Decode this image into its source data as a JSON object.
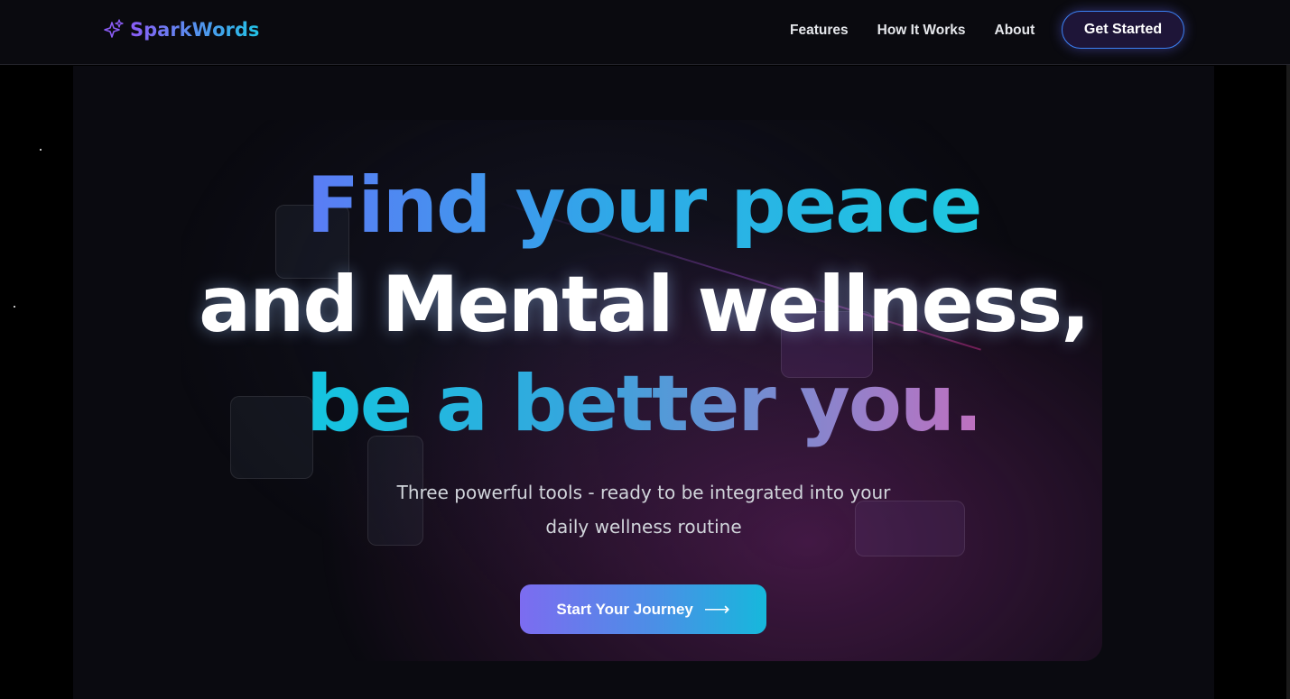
{
  "brand": {
    "name": "SparkWords",
    "icon": "sparkles-icon",
    "colors": [
      "#8b5cf6",
      "#22c3e6"
    ]
  },
  "nav": {
    "links": [
      "Features",
      "How It Works",
      "About"
    ],
    "cta_label": "Get Started"
  },
  "hero": {
    "line1": "Find your peace",
    "line2": "and Mental wellness,",
    "line3": "be a better you.",
    "subtitle_line1": "Three powerful tools - ready to be integrated into your",
    "subtitle_line2": "daily wellness routine",
    "cta_label": "Start Your Journey",
    "cta_icon": "arrow-right-icon"
  },
  "colors": {
    "background": "#000000",
    "panel": "#0a0a10",
    "accent_blue": "#22c3e6",
    "accent_purple": "#8b5cf6"
  }
}
